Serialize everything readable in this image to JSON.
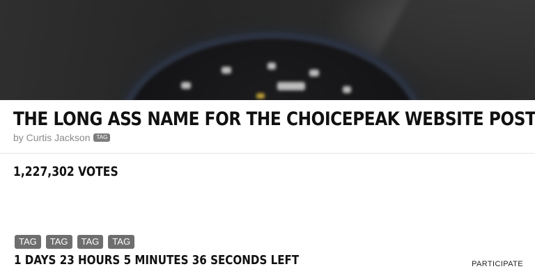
{
  "post": {
    "title": "The Long Ass Name for the Choicepeak Website Post",
    "byline": "by Curtis Jackson",
    "author_tag": "TAG",
    "hero_image": "blurred-watch-photo"
  },
  "stats": {
    "votes": "1,227,302 Votes"
  },
  "tags": [
    "TAG",
    "TAG",
    "TAG",
    "TAG"
  ],
  "countdown": "1 Days 23 Hours 5 Minutes 36 Seconds Left",
  "actions": {
    "participate_label": "PARTICIPATE"
  },
  "colors": {
    "title": "#111111",
    "byline": "#8a8a8a",
    "tag_background": "#6e6e6e",
    "tag_text": "#ffffff",
    "divider": "#e4e4e4"
  }
}
